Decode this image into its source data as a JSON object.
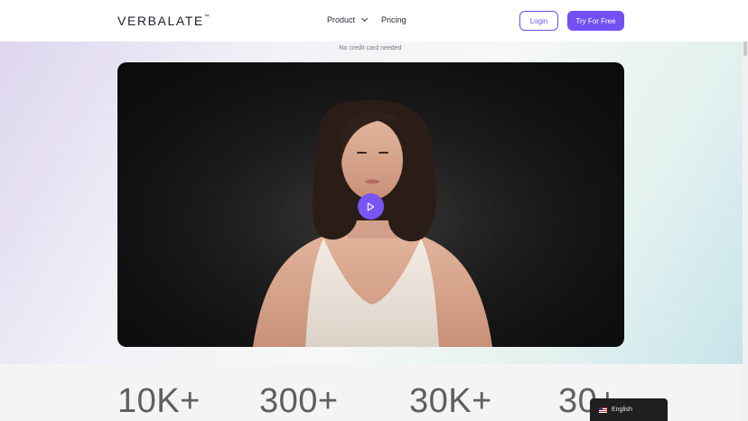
{
  "header": {
    "logo_text": "VERBALATE",
    "logo_tm": "™",
    "nav_product": "Product",
    "nav_pricing": "Pricing",
    "login_label": "Login",
    "try_label": "Try For Free"
  },
  "hero": {
    "no_credit_card": "No credit card needed"
  },
  "stats": [
    "10K+",
    "300+",
    "30K+",
    "30+"
  ],
  "language": {
    "label": "English",
    "flag_icon": "us-flag-icon"
  },
  "colors": {
    "accent": "#7250f3",
    "play_button": "#7a55f5"
  }
}
